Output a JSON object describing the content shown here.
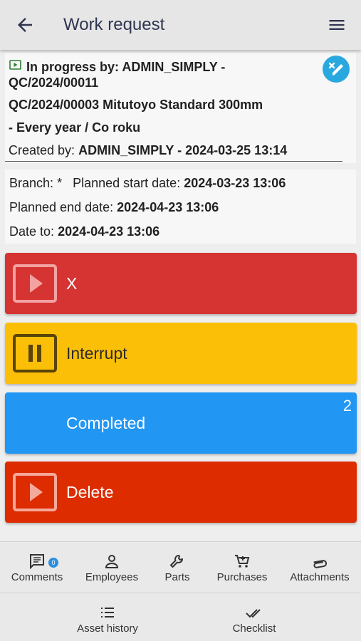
{
  "header": {
    "title": "Work request"
  },
  "request": {
    "status_text": "In progress by: ADMIN_SIMPLY -",
    "id": "QC/2024/00011",
    "asset_line": "QC/2024/00003 Mitutoyo Standard 300mm",
    "schedule_line": "- Every year / Co roku",
    "created_label": "Created by:",
    "created_value": "ADMIN_SIMPLY - 2024-03-25 13:14"
  },
  "details": {
    "branch_label": "Branch:",
    "branch_value": "*",
    "planned_start_label": "Planned start date:",
    "planned_start_value": "2024-03-23 13:06",
    "planned_end_label": "Planned end date:",
    "planned_end_value": "2024-04-23 13:06",
    "date_to_label": "Date to:",
    "date_to_value": "2024-04-23 13:06"
  },
  "actions": [
    {
      "label": "X",
      "color": "#d63333",
      "icon": "play-icon"
    },
    {
      "label": "Interrupt",
      "color": "#fbbf08",
      "icon": "pause-icon"
    },
    {
      "label": "Completed",
      "color": "#2196f3",
      "count": "2"
    },
    {
      "label": "Delete",
      "color": "#dd2c00",
      "icon": "play-icon"
    }
  ],
  "bottom_nav": {
    "row1": [
      {
        "label": "Comments",
        "icon": "comment-icon",
        "badge": "0"
      },
      {
        "label": "Employees",
        "icon": "person-icon"
      },
      {
        "label": "Parts",
        "icon": "wrench-icon"
      },
      {
        "label": "Purchases",
        "icon": "cart-icon"
      },
      {
        "label": "Attachments",
        "icon": "paperclip-icon"
      }
    ],
    "row2": [
      {
        "label": "Asset history",
        "icon": "list-icon"
      },
      {
        "label": "Checklist",
        "icon": "double-check-icon"
      }
    ]
  },
  "colors": {
    "appbar": "#e6e6e6",
    "title_text": "#2f3550",
    "badge_blue": "#29a8e0"
  }
}
